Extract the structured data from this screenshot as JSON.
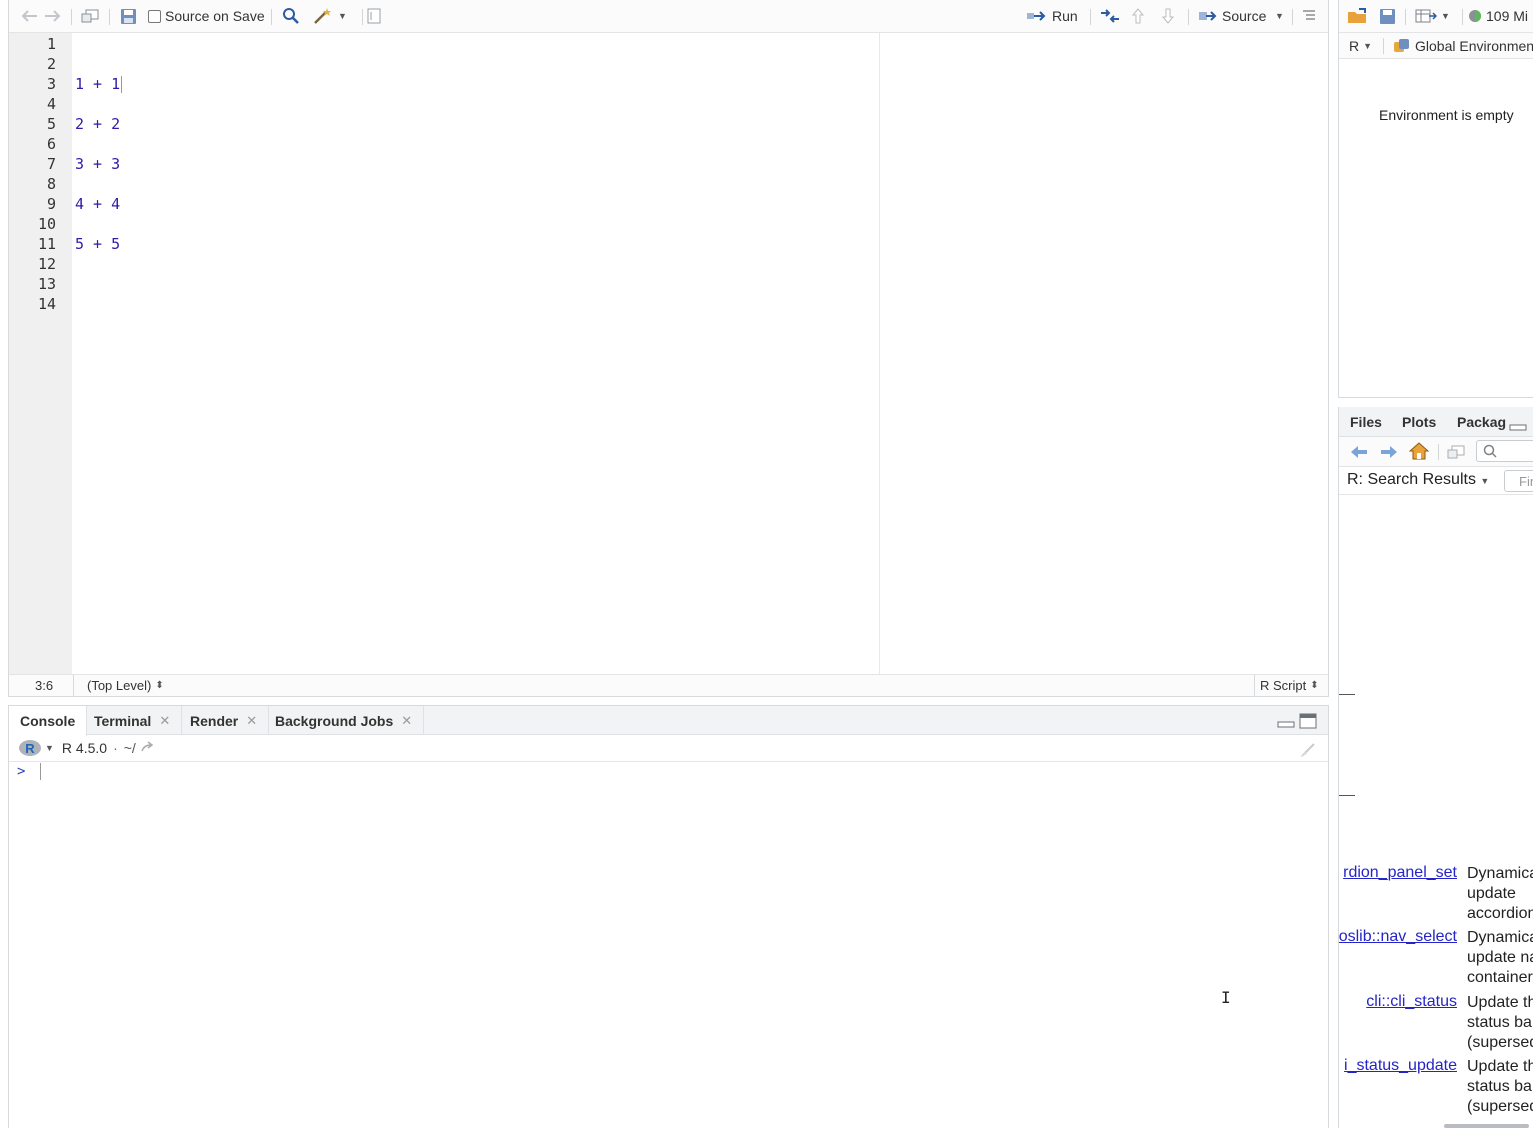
{
  "editor": {
    "toolbar": {
      "source_on_save": "Source on Save",
      "run": "Run",
      "source": "Source"
    },
    "line_numbers": [
      "1",
      "2",
      "3",
      "4",
      "5",
      "6",
      "7",
      "8",
      "9",
      "10",
      "11",
      "12",
      "13",
      "14"
    ],
    "code_lines": [
      "",
      "",
      "1 + 1",
      "",
      "2 + 2",
      "",
      "3 + 3",
      "",
      "4 + 4",
      "",
      "5 + 5",
      "",
      "",
      ""
    ],
    "status": {
      "position": "3:6",
      "scope": "(Top Level)",
      "file_type": "R Script"
    }
  },
  "console": {
    "tabs": [
      {
        "label": "Console",
        "closable": false
      },
      {
        "label": "Terminal",
        "closable": true
      },
      {
        "label": "Render",
        "closable": true
      },
      {
        "label": "Background Jobs",
        "closable": true
      }
    ],
    "r_version": "R 4.5.0",
    "separator": "·",
    "working_dir": "~/",
    "prompt": ">"
  },
  "environment": {
    "memory": "109 Mi",
    "language": "R",
    "scope": "Global Environmen",
    "empty_message": "Environment is empty"
  },
  "files": {
    "tabs": [
      "Files",
      "Plots",
      "Packag"
    ],
    "help_title": "R: Search Results",
    "find_placeholder": "Fin",
    "results": [
      {
        "link": "rdion_panel_set",
        "desc": [
          "Dynamica",
          "update",
          "accordion"
        ]
      },
      {
        "link": "oslib::nav_select",
        "desc": [
          "Dynamica",
          "update na",
          "container"
        ]
      },
      {
        "link": "cli::cli_status",
        "desc": [
          "Update th",
          "status ba",
          "(supersed"
        ]
      },
      {
        "link": "i_status_update",
        "desc": [
          "Update th",
          "status ba",
          "(supersed"
        ]
      }
    ]
  },
  "colors": {
    "code": "#2e1ba8",
    "link": "#2424c8",
    "accent": "#2165b6"
  }
}
